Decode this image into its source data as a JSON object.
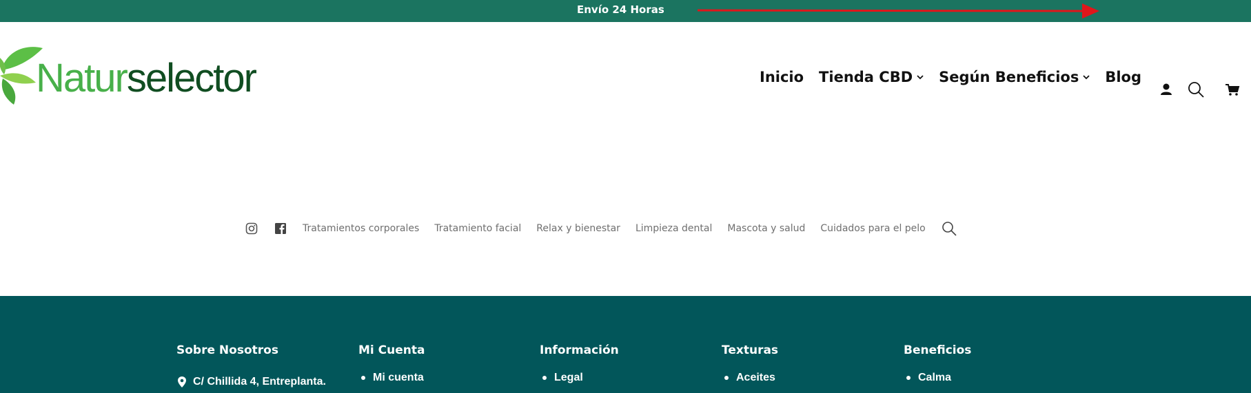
{
  "topbar": {
    "promo": "Envío 24 Horas",
    "arrow_color": "#e0161b"
  },
  "logo": {
    "part1": "Natur",
    "part2": "selector"
  },
  "main_nav": [
    {
      "label": "Inicio",
      "has_dropdown": false
    },
    {
      "label": "Tienda CBD",
      "has_dropdown": true
    },
    {
      "label": "Según Beneficios",
      "has_dropdown": true
    },
    {
      "label": "Blog",
      "has_dropdown": false
    }
  ],
  "header_icons": [
    "user-icon",
    "search-icon",
    "cart-icon"
  ],
  "secondary_menu": {
    "icons": [
      "instagram-icon",
      "facebook-icon"
    ],
    "links": [
      "Tratamientos corporales",
      "Tratamiento facial",
      "Relax y bienestar",
      "Limpieza dental",
      "Mascota y salud",
      "Cuidados para el pelo"
    ]
  },
  "footer": {
    "columns": [
      {
        "title": "Sobre Nosotros",
        "address": "C/ Chillida 4, Entreplanta."
      },
      {
        "title": "Mi Cuenta",
        "items": [
          "Mi cuenta"
        ]
      },
      {
        "title": "Información",
        "items": [
          "Legal"
        ]
      },
      {
        "title": "Texturas",
        "items": [
          "Aceites"
        ]
      },
      {
        "title": "Beneficios",
        "items": [
          "Calma"
        ]
      }
    ]
  },
  "colors": {
    "topbar": "#1b7460",
    "footer": "#02565a",
    "logo_light": "#48b04a",
    "logo_dark": "#104d21"
  }
}
